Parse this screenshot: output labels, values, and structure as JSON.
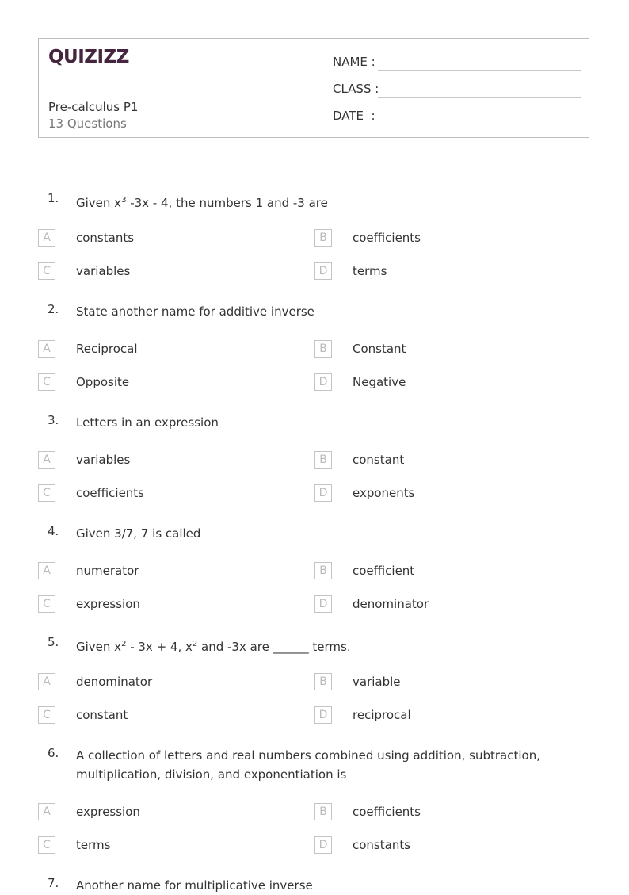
{
  "header": {
    "logo": "QUIZIZZ",
    "title": "Pre-calculus P1",
    "question_count": "13 Questions",
    "fields": [
      {
        "label": "NAME :"
      },
      {
        "label": "CLASS :"
      },
      {
        "label": "DATE  :"
      }
    ]
  },
  "questions": [
    {
      "num": "1.",
      "text_pre": "Given x",
      "sup": "3",
      "text_post": " -3x - 4, the numbers 1 and -3 are",
      "options": [
        {
          "letter": "A",
          "text": "constants"
        },
        {
          "letter": "B",
          "text": "coefficients"
        },
        {
          "letter": "C",
          "text": "variables"
        },
        {
          "letter": "D",
          "text": "terms"
        }
      ]
    },
    {
      "num": "2.",
      "text": "State another name for additive inverse",
      "options": [
        {
          "letter": "A",
          "text": "Reciprocal"
        },
        {
          "letter": "B",
          "text": "Constant"
        },
        {
          "letter": "C",
          "text": "Opposite"
        },
        {
          "letter": "D",
          "text": "Negative"
        }
      ]
    },
    {
      "num": "3.",
      "text": "Letters in an expression",
      "options": [
        {
          "letter": "A",
          "text": "variables"
        },
        {
          "letter": "B",
          "text": "constant"
        },
        {
          "letter": "C",
          "text": "coefficients"
        },
        {
          "letter": "D",
          "text": "exponents"
        }
      ]
    },
    {
      "num": "4.",
      "text": "Given 3/7, 7 is called",
      "options": [
        {
          "letter": "A",
          "text": "numerator"
        },
        {
          "letter": "B",
          "text": "coefficient"
        },
        {
          "letter": "C",
          "text": "expression"
        },
        {
          "letter": "D",
          "text": "denominator"
        }
      ]
    },
    {
      "num": "5.",
      "text_pre": "Given x",
      "sup": "2",
      "text_mid": " - 3x + 4, x",
      "sup2": "2",
      "text_post": " and -3x are ______ terms.",
      "options": [
        {
          "letter": "A",
          "text": "denominator"
        },
        {
          "letter": "B",
          "text": "variable"
        },
        {
          "letter": "C",
          "text": "constant"
        },
        {
          "letter": "D",
          "text": "reciprocal"
        }
      ]
    },
    {
      "num": "6.",
      "text": "A collection of letters and real numbers combined using addition, subtraction, multiplication, division, and exponentiation is",
      "options": [
        {
          "letter": "A",
          "text": "expression"
        },
        {
          "letter": "B",
          "text": "coefficients"
        },
        {
          "letter": "C",
          "text": "terms"
        },
        {
          "letter": "D",
          "text": "constants"
        }
      ]
    },
    {
      "num": "7.",
      "text": "Another name for multiplicative inverse",
      "options": []
    }
  ]
}
